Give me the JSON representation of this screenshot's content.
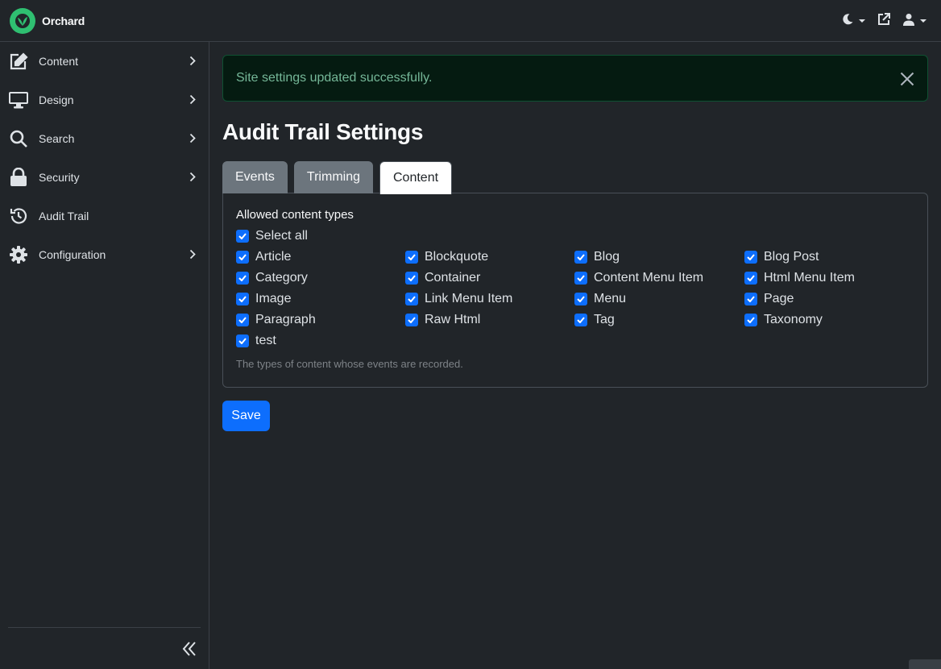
{
  "app": {
    "name": "Orchard"
  },
  "sidebar": {
    "items": [
      {
        "label": "Content",
        "icon": "edit-icon",
        "has_submenu": true
      },
      {
        "label": "Design",
        "icon": "desktop-icon",
        "has_submenu": true
      },
      {
        "label": "Search",
        "icon": "search-icon",
        "has_submenu": true
      },
      {
        "label": "Security",
        "icon": "lock-icon",
        "has_submenu": true
      },
      {
        "label": "Audit Trail",
        "icon": "history-icon",
        "has_submenu": false
      },
      {
        "label": "Configuration",
        "icon": "gear-icon",
        "has_submenu": true
      }
    ]
  },
  "alert": {
    "message": "Site settings updated successfully.",
    "type": "success"
  },
  "page": {
    "title": "Audit Trail Settings"
  },
  "tabs": [
    {
      "label": "Events",
      "active": false
    },
    {
      "label": "Trimming",
      "active": false
    },
    {
      "label": "Content",
      "active": true
    }
  ],
  "content_tab": {
    "group_label": "Allowed content types",
    "select_all_label": "Select all",
    "types": [
      {
        "label": "Article",
        "checked": true
      },
      {
        "label": "Blockquote",
        "checked": true
      },
      {
        "label": "Blog",
        "checked": true
      },
      {
        "label": "Blog Post",
        "checked": true
      },
      {
        "label": "Category",
        "checked": true
      },
      {
        "label": "Container",
        "checked": true
      },
      {
        "label": "Content Menu Item",
        "checked": true
      },
      {
        "label": "Html Menu Item",
        "checked": true
      },
      {
        "label": "Image",
        "checked": true
      },
      {
        "label": "Link Menu Item",
        "checked": true
      },
      {
        "label": "Menu",
        "checked": true
      },
      {
        "label": "Page",
        "checked": true
      },
      {
        "label": "Paragraph",
        "checked": true
      },
      {
        "label": "Raw Html",
        "checked": true
      },
      {
        "label": "Tag",
        "checked": true
      },
      {
        "label": "Taxonomy",
        "checked": true
      },
      {
        "label": "test",
        "checked": true
      }
    ],
    "hint": "The types of content whose events are recorded."
  },
  "actions": {
    "save_label": "Save"
  },
  "colors": {
    "primary": "#0d6efd",
    "success_text": "#75b798",
    "background": "#212529",
    "brand": "#2fbf71"
  }
}
